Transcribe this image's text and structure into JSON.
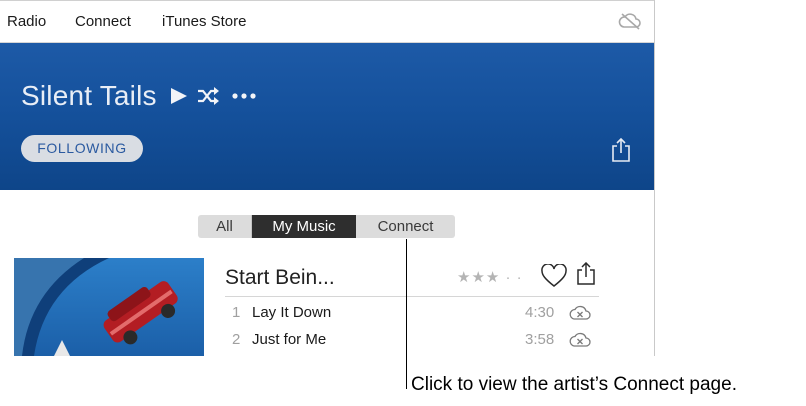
{
  "nav": {
    "items": [
      {
        "label": "Radio"
      },
      {
        "label": "Connect"
      },
      {
        "label": "iTunes Store"
      }
    ],
    "cloud_icon": "cloud-off-icon"
  },
  "artist": {
    "name": "Silent Tails",
    "follow_label": "FOLLOWING",
    "play_icon": "play-icon",
    "shuffle_icon": "shuffle-icon",
    "more_icon": "more-icon",
    "share_icon": "share-icon",
    "banner_color": "#1a56a3"
  },
  "segments": {
    "items": [
      {
        "label": "All",
        "active": false
      },
      {
        "label": "My Music",
        "active": true
      },
      {
        "label": "Connect",
        "active": false
      }
    ]
  },
  "album": {
    "title": "Start Bein...",
    "rating_text": "★★★ · ·",
    "heart_icon": "heart-icon",
    "share_icon": "share-icon",
    "tracks": [
      {
        "number": "1",
        "title": "Lay It Down",
        "duration": "4:30",
        "icon": "cloud-download-icon"
      },
      {
        "number": "2",
        "title": "Just for Me",
        "duration": "3:58",
        "icon": "cloud-download-icon"
      }
    ]
  },
  "callout": {
    "text": "Click to view the artist’s Connect page."
  }
}
